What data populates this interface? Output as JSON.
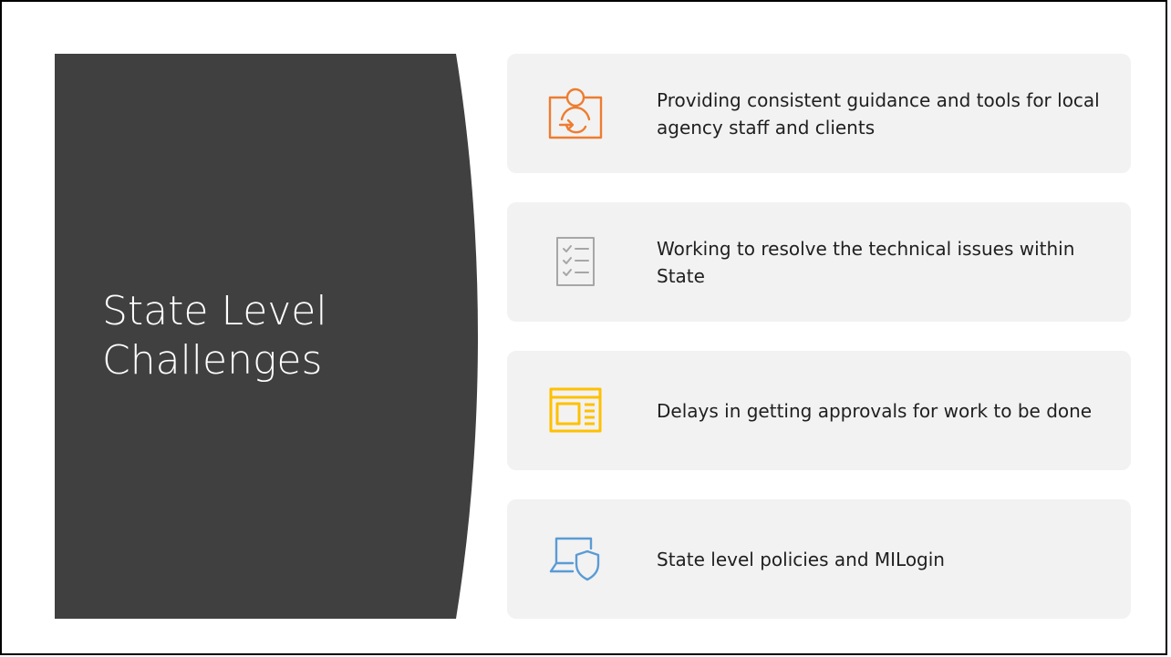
{
  "slide": {
    "title": "State Level\nChallenges",
    "panel_color": "#404040",
    "items": [
      {
        "text": "Providing consistent guidance and tools for local agency staff and clients",
        "icon": "user-arrow-icon",
        "icon_color": "#ed7d31"
      },
      {
        "text": "Working to resolve the technical issues within State",
        "icon": "checklist-icon",
        "icon_color": "#a6a6a6"
      },
      {
        "text": "Delays in getting approvals for work to be done",
        "icon": "layout-window-icon",
        "icon_color": "#ffc000"
      },
      {
        "text": "State level policies and MILogin",
        "icon": "laptop-shield-icon",
        "icon_color": "#5b9bd5"
      }
    ]
  }
}
